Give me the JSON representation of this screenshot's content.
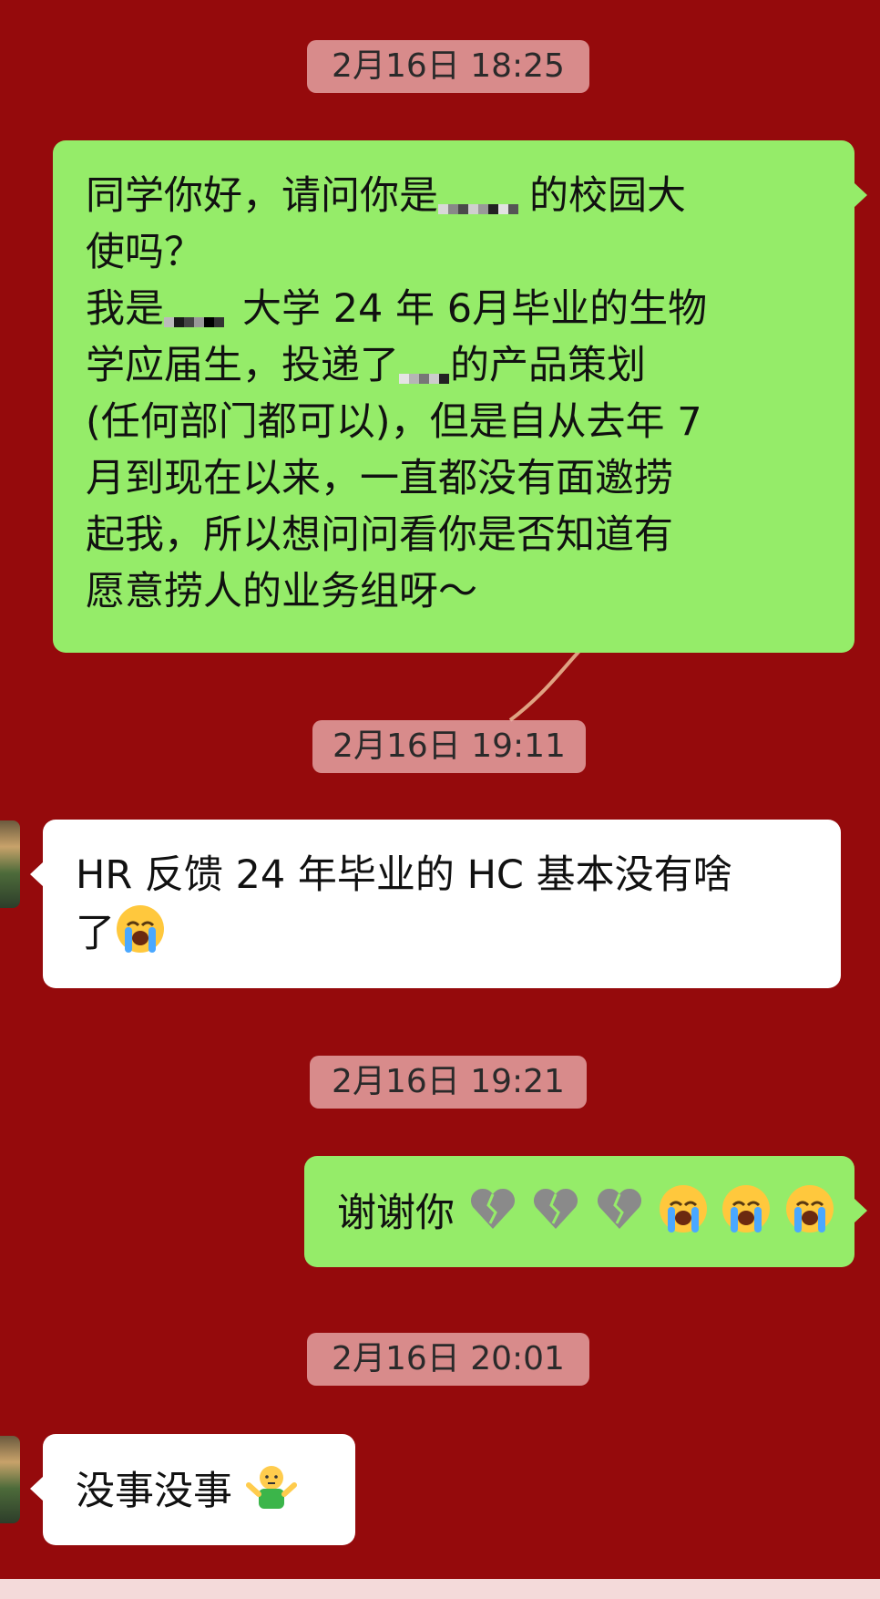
{
  "chat": {
    "ts1": "2月16日 18:25",
    "msg1": {
      "line1_a": "同学你好，请问你是",
      "line1_b": "的校园大",
      "line2": "使吗？",
      "line3_a": "我是",
      "line3_b": "大学 24 年 6月毕业的生物",
      "line4_a": "学应届生，投递了",
      "line4_b": "的产品策划",
      "line5": "(任何部门都可以)，但是自从去年 7",
      "line6": "月到现在以来，一直都没有面邀捞",
      "line7": "起我，所以想问问看你是否知道有",
      "line8": "愿意捞人的业务组呀～"
    },
    "ts2": "2月16日 19:11",
    "msg2": {
      "line1": "HR 反馈 24 年毕业的 HC 基本没有啥",
      "line2": "了"
    },
    "ts3": "2月16日 19:21",
    "msg3": {
      "text": "谢谢你"
    },
    "ts4": "2月16日 20:01",
    "msg4": {
      "text": "没事没事"
    }
  },
  "colors": {
    "background": "#950a0c",
    "outgoing_bubble": "#95ec69",
    "incoming_bubble": "#ffffff",
    "timestamp_bg": "#ebafaf"
  },
  "icons": {
    "msg2": "loudly-crying-face-icon",
    "msg3": [
      "broken-heart-icon",
      "broken-heart-icon",
      "broken-heart-icon",
      "loudly-crying-face-icon",
      "loudly-crying-face-icon",
      "loudly-crying-face-icon"
    ],
    "msg4": "person-shrugging-emoji-icon"
  }
}
